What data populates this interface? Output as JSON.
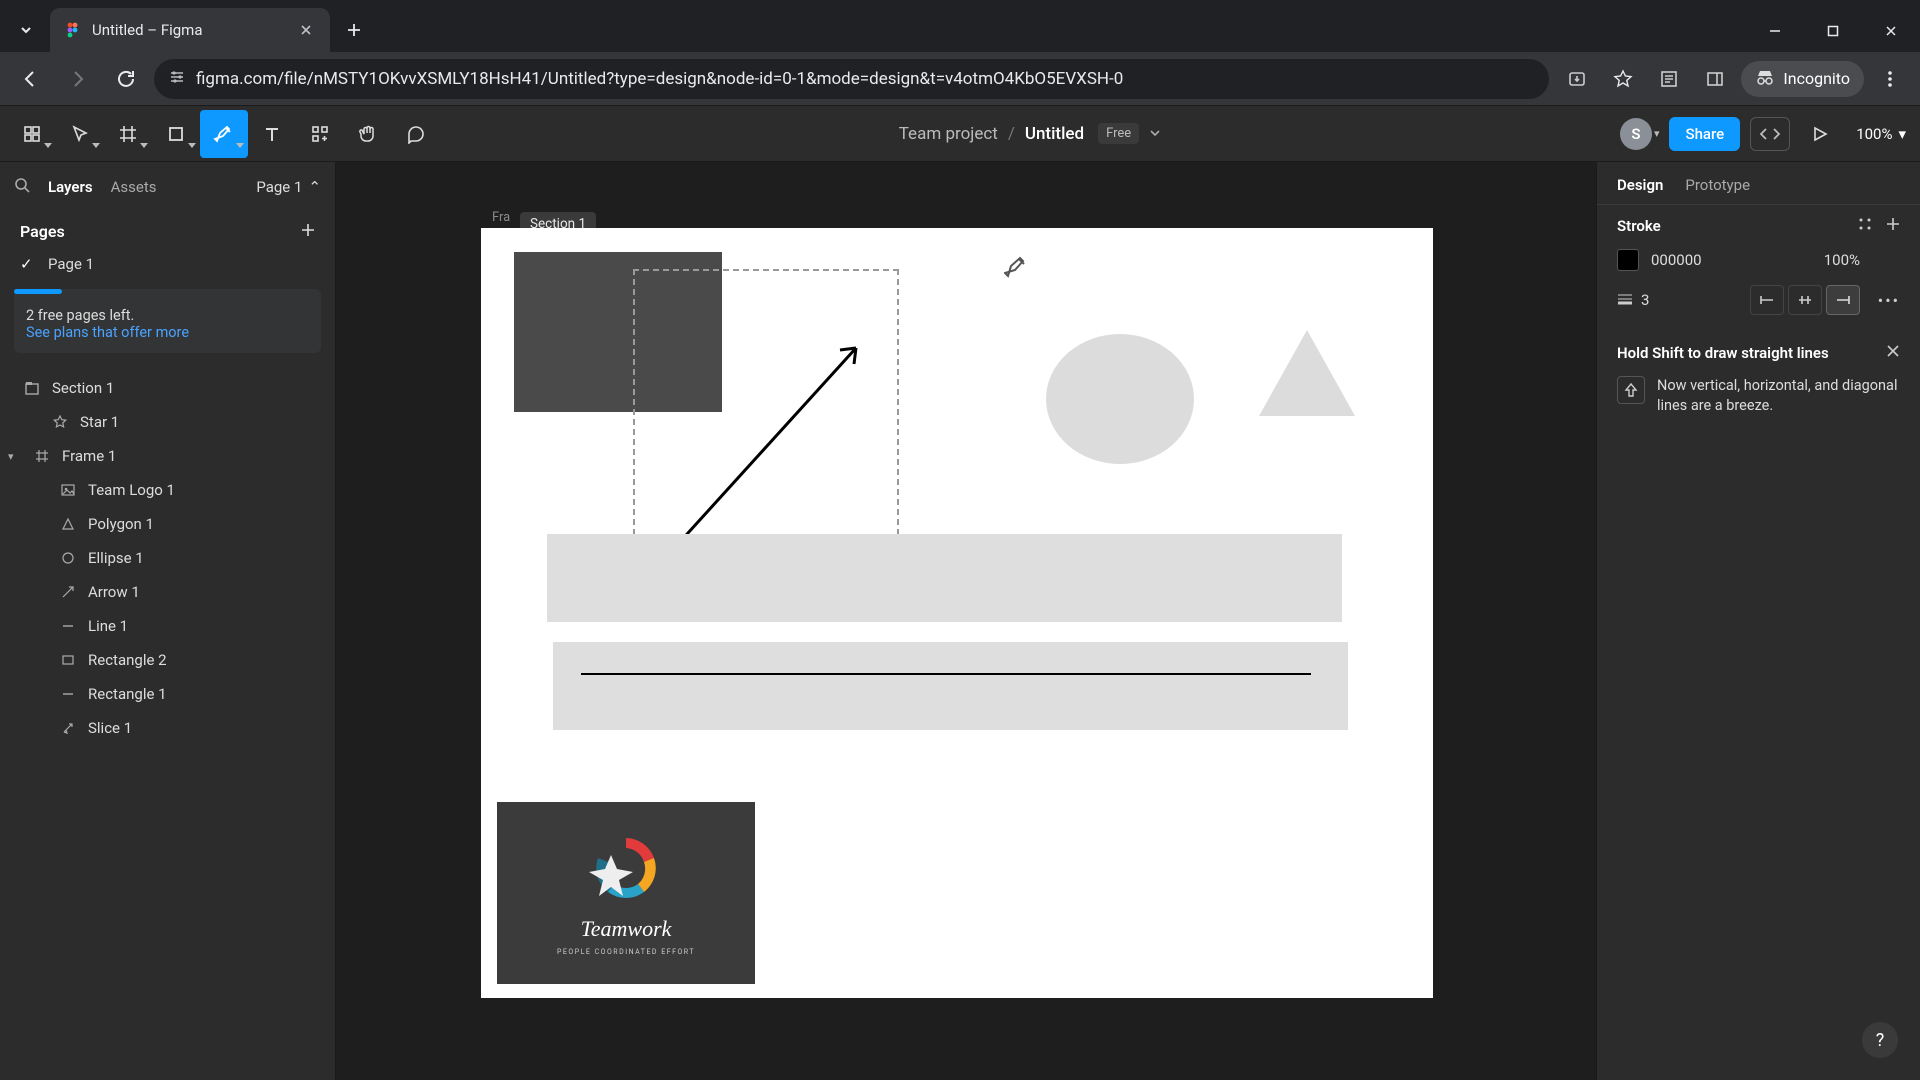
{
  "browser": {
    "tab_title": "Untitled – Figma",
    "url": "figma.com/file/nMSTY1OKvvXSMLY18HsH41/Untitled?type=design&node-id=0-1&mode=design&t=v4otmO4KbO5EVXSH-0",
    "incognito_label": "Incognito"
  },
  "toolbar": {
    "project": "Team project",
    "file": "Untitled",
    "plan_badge": "Free",
    "share_label": "Share",
    "avatar_initial": "S",
    "zoom": "100%"
  },
  "leftpanel": {
    "tab_layers": "Layers",
    "tab_assets": "Assets",
    "page_switch": "Page 1",
    "pages_header": "Pages",
    "page1": "Page 1",
    "promo_line1": "2 free pages left.",
    "promo_link": "See plans that offer more",
    "layers": {
      "section1": "Section 1",
      "star1": "Star 1",
      "frame1": "Frame 1",
      "teamlogo1": "Team Logo 1",
      "polygon1": "Polygon 1",
      "ellipse1": "Ellipse 1",
      "arrow1": "Arrow 1",
      "line1": "Line 1",
      "rectangle2": "Rectangle 2",
      "rectangle1": "Rectangle 1",
      "slice1": "Slice 1"
    }
  },
  "canvas": {
    "frame_label_truncated": "Fra",
    "section_pill": "Section 1",
    "logo_title": "Teamwork",
    "logo_sub": "PEOPLE COORDINATED EFFORT"
  },
  "rightpanel": {
    "tab_design": "Design",
    "tab_prototype": "Prototype",
    "stroke_header": "Stroke",
    "stroke_color_hex": "000000",
    "stroke_alpha": "100%",
    "stroke_width": "3",
    "tip_title": "Hold Shift to draw straight lines",
    "tip_body": "Now vertical, horizontal, and diagonal lines are a breeze."
  }
}
